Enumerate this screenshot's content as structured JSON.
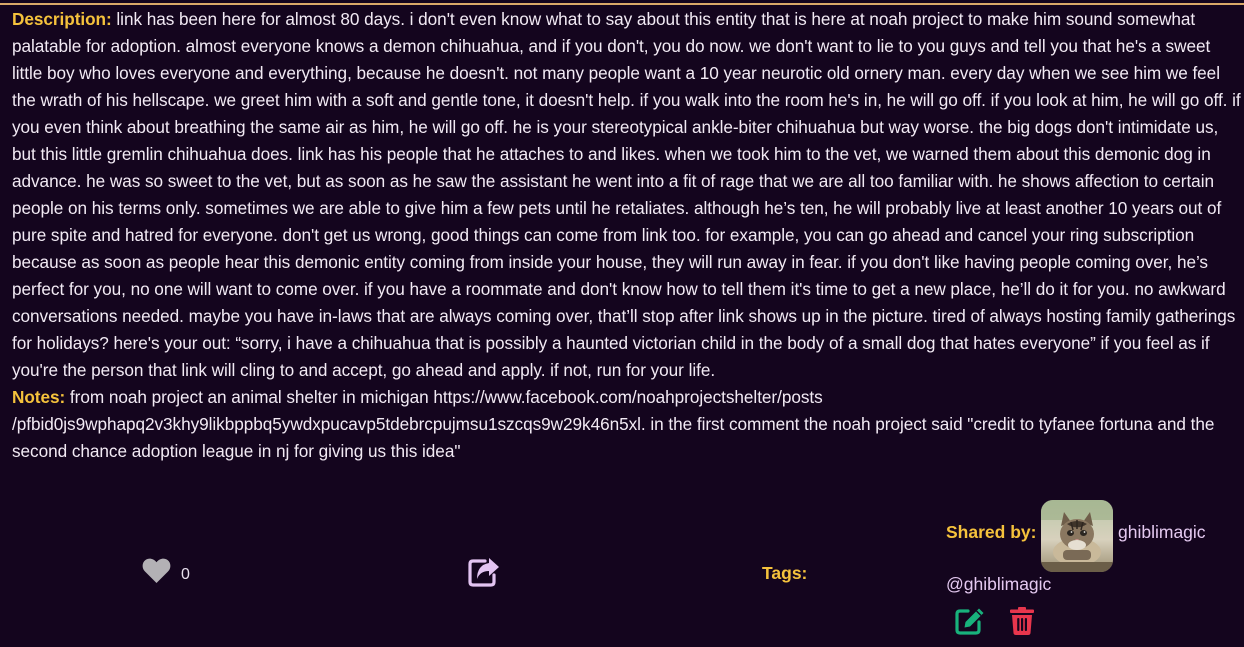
{
  "description": {
    "label": "Description:",
    "text": "link has been here for almost 80 days. i don't even know what to say about this entity that is here at noah project to make him sound somewhat palatable for adoption. almost everyone knows a demon chihuahua, and if you don't, you do now. we don't want to lie to you guys and tell you that he's a sweet little boy who loves everyone and everything, because he doesn't. not many people want a 10 year neurotic old ornery man. every day when we see him we feel the wrath of his hellscape. we greet him with a soft and gentle tone, it doesn't help. if you walk into the room he's in, he will go off. if you look at him, he will go off. if you even think about breathing the same air as him, he will go off. he is your stereotypical ankle-biter chihuahua but way worse. the big dogs don't intimidate us, but this little gremlin chihuahua does. link has his people that he attaches to and likes. when we took him to the vet, we warned them about this demonic dog in advance. he was so sweet to the vet, but as soon as he saw the assistant he went into a fit of rage that we are all too familiar with. he shows affection to certain people on his terms only. sometimes we are able to give him a few pets until he retaliates. although he’s ten, he will probably live at least another 10 years out of pure spite and hatred for everyone. don't get us wrong, good things can come from link too. for example, you can go ahead and cancel your ring subscription because as soon as people hear this demonic entity coming from inside your house, they will run away in fear. if you don't like having people coming over, he’s perfect for you, no one will want to come over. if you have a roommate and don't know how to tell them it's time to get a new place, he’ll do it for you. no awkward conversations needed. maybe you have in-laws that are always coming over, that’ll stop after link shows up in the picture. tired of always hosting family gatherings for holidays? here's your out: “sorry, i have a chihuahua that is possibly a haunted victorian child in the body of a small dog that hates everyone” if you feel as if you're the person that link will cling to and accept, go ahead and apply. if not, run for your life."
  },
  "notes": {
    "label": "Notes:",
    "text": "from noah project an animal shelter in michigan https://www.facebook.com/noahprojectshelter/posts /pfbid0js9wphapq2v3khy9likbppbq5ywdxpucavp5tdebrcpujmsu1szcqs9w29k46n5xl. in the first comment the noah project said \"credit to tyfanee fortuna and the second chance adoption league in nj for giving us this idea\""
  },
  "footer": {
    "like_icon": "heart-icon",
    "like_count": "0",
    "share_icon": "share-icon",
    "tags_label": "Tags:",
    "shared_by_label": "Shared by:",
    "username": "ghiblimagic",
    "handle": "@ghiblimagic",
    "edit_icon": "edit-icon",
    "delete_icon": "trash-icon"
  },
  "colors": {
    "background": "#14051e",
    "label": "#f5c23c",
    "text": "#f2eaf4",
    "username": "#e4c9f0",
    "like_icon": "#b3b1b5",
    "share_icon": "#e3c4f2",
    "edit_icon": "#18b27c",
    "delete_icon": "#e8364d"
  }
}
